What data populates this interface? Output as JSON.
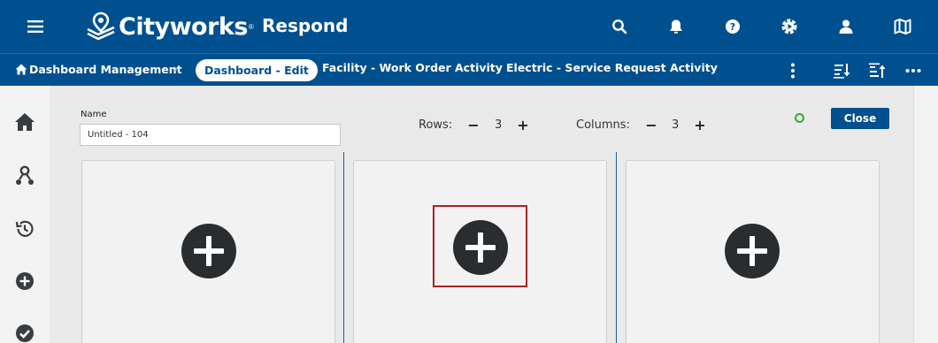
{
  "header": {
    "menu_icon": "hamburger-menu-icon",
    "brand": "Cityworks",
    "brand_reg": "®",
    "app_name": "Respond",
    "icons": [
      "search-icon",
      "bell-icon",
      "help-icon",
      "settings-icon",
      "user-icon",
      "map-icon"
    ]
  },
  "tabbar": {
    "home_label": "Dashboard Management",
    "separator": "›",
    "active_tab": "Dashboard - Edit",
    "tabs": [
      "Facility - Work Order Activity",
      "Electric - Service Request Activity"
    ],
    "icons": [
      "more-vertical-icon",
      "sort-descending-icon",
      "sort-ascending-icon",
      "more-horizontal-icon"
    ]
  },
  "sidebar": {
    "icons": [
      "home-icon",
      "workflow-icon",
      "history-icon",
      "add-circle-icon",
      "check-circle-icon"
    ]
  },
  "editor": {
    "name_label": "Name",
    "name_value": "Untitled - 104",
    "rows_label": "Rows:",
    "rows_value": "3",
    "columns_label": "Columns:",
    "columns_value": "3",
    "minus": "−",
    "plus": "+",
    "close_label": "Close",
    "status_color": "#3aaa35"
  },
  "panels": [
    {
      "action": "add-widget"
    },
    {
      "action": "add-widget",
      "highlighted": true
    },
    {
      "action": "add-widget"
    }
  ],
  "colors": {
    "brand_blue": "#00508f",
    "highlight_red": "#b22024"
  }
}
